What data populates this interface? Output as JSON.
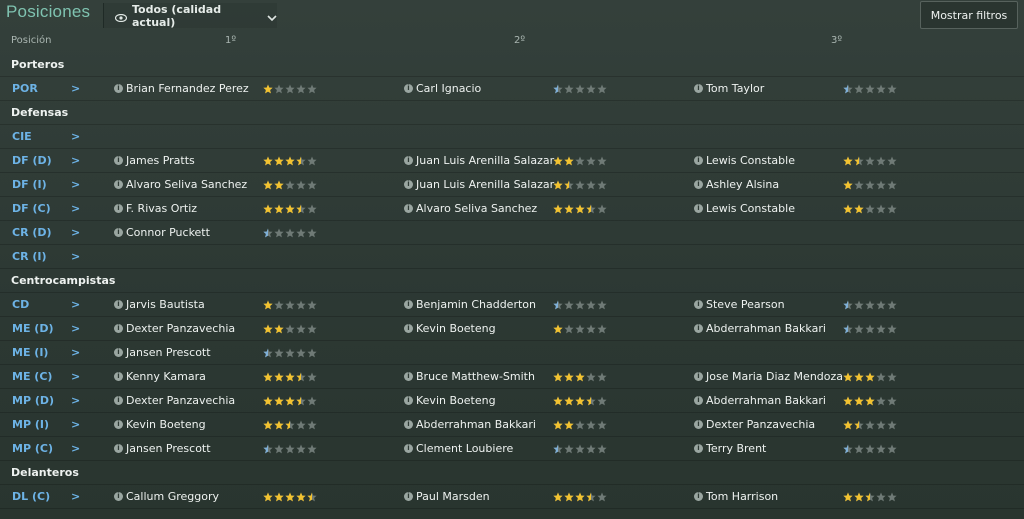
{
  "header": {
    "title": "Posiciones",
    "view_label": "Todos (calidad actual)",
    "filters_button": "Mostrar filtros"
  },
  "columns": {
    "position": "Posición",
    "first": "1º",
    "second": "2º",
    "third": "3º"
  },
  "colors": {
    "star_filled": "#f2c230",
    "star_empty": "#6f7a76",
    "half_star_blue": "#7fb0d8",
    "position_text": "#6db3e6"
  },
  "rows": [
    {
      "type": "section",
      "label": "Porteros"
    },
    {
      "type": "pos",
      "label": "POR",
      "players": [
        {
          "name": "Brian Fernandez Perez",
          "rating": 1
        },
        {
          "name": "Carl Ignacio",
          "rating": 0.5
        },
        {
          "name": "Tom Taylor",
          "rating": 0.5
        }
      ]
    },
    {
      "type": "section",
      "label": "Defensas"
    },
    {
      "type": "pos",
      "label": "CIE",
      "players": []
    },
    {
      "type": "pos",
      "label": "DF (D)",
      "players": [
        {
          "name": "James Pratts",
          "rating": 3.5
        },
        {
          "name": "Juan Luis Arenilla Salazar",
          "rating": 2
        },
        {
          "name": "Lewis Constable",
          "rating": 1.5
        }
      ]
    },
    {
      "type": "pos",
      "label": "DF (I)",
      "players": [
        {
          "name": "Alvaro Seliva Sanchez",
          "rating": 2
        },
        {
          "name": "Juan Luis Arenilla Salazar",
          "rating": 1.5
        },
        {
          "name": "Ashley Alsina",
          "rating": 1
        }
      ]
    },
    {
      "type": "pos",
      "label": "DF (C)",
      "players": [
        {
          "name": "F. Rivas Ortiz",
          "rating": 3.5
        },
        {
          "name": "Alvaro Seliva Sanchez",
          "rating": 3.5
        },
        {
          "name": "Lewis Constable",
          "rating": 2
        }
      ]
    },
    {
      "type": "pos",
      "label": "CR (D)",
      "players": [
        {
          "name": "Connor Puckett",
          "rating": 0.5
        }
      ]
    },
    {
      "type": "pos",
      "label": "CR (I)",
      "players": []
    },
    {
      "type": "section",
      "label": "Centrocampistas"
    },
    {
      "type": "pos",
      "label": "CD",
      "players": [
        {
          "name": "Jarvis Bautista",
          "rating": 1
        },
        {
          "name": "Benjamin Chadderton",
          "rating": 0.5
        },
        {
          "name": "Steve Pearson",
          "rating": 0.5
        }
      ]
    },
    {
      "type": "pos",
      "label": "ME (D)",
      "players": [
        {
          "name": "Dexter Panzavechia",
          "rating": 2
        },
        {
          "name": "Kevin Boeteng",
          "rating": 1
        },
        {
          "name": "Abderrahman Bakkari",
          "rating": 0.5
        }
      ]
    },
    {
      "type": "pos",
      "label": "ME (I)",
      "players": [
        {
          "name": "Jansen Prescott",
          "rating": 0.5
        }
      ]
    },
    {
      "type": "pos",
      "label": "ME (C)",
      "players": [
        {
          "name": "Kenny Kamara",
          "rating": 3.5
        },
        {
          "name": "Bruce Matthew-Smith",
          "rating": 3
        },
        {
          "name": "Jose Maria Diaz Mendoza",
          "rating": 3
        }
      ]
    },
    {
      "type": "pos",
      "label": "MP (D)",
      "players": [
        {
          "name": "Dexter Panzavechia",
          "rating": 3.5
        },
        {
          "name": "Kevin Boeteng",
          "rating": 3.5
        },
        {
          "name": "Abderrahman Bakkari",
          "rating": 3
        }
      ]
    },
    {
      "type": "pos",
      "label": "MP (I)",
      "players": [
        {
          "name": "Kevin Boeteng",
          "rating": 2.5
        },
        {
          "name": "Abderrahman Bakkari",
          "rating": 2
        },
        {
          "name": "Dexter Panzavechia",
          "rating": 1.5
        }
      ]
    },
    {
      "type": "pos",
      "label": "MP (C)",
      "players": [
        {
          "name": "Jansen Prescott",
          "rating": 0.5
        },
        {
          "name": "Clement Loubiere",
          "rating": 0.5
        },
        {
          "name": "Terry Brent",
          "rating": 0.5
        }
      ]
    },
    {
      "type": "section",
      "label": "Delanteros"
    },
    {
      "type": "pos",
      "label": "DL (C)",
      "players": [
        {
          "name": "Callum Greggory",
          "rating": 4.5
        },
        {
          "name": "Paul Marsden",
          "rating": 3.5
        },
        {
          "name": "Tom Harrison",
          "rating": 2.5
        }
      ]
    }
  ]
}
